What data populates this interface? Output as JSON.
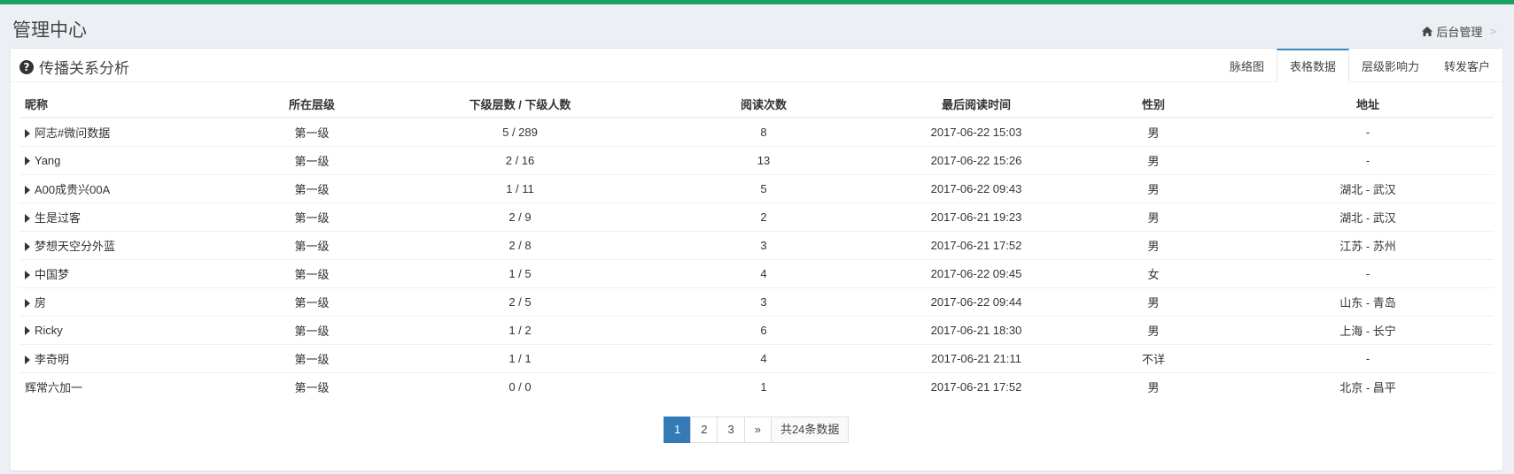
{
  "header": {
    "title": "管理中心",
    "breadcrumb": {
      "home_label": "后台管理",
      "separator": ">"
    }
  },
  "box": {
    "title": "传播关系分析",
    "tabs": [
      {
        "label": "脉络图",
        "active": false
      },
      {
        "label": "表格数据",
        "active": true
      },
      {
        "label": "层级影响力",
        "active": false
      },
      {
        "label": "转发客户",
        "active": false
      }
    ]
  },
  "table": {
    "columns": [
      "昵称",
      "所在层级",
      "下级层数 / 下级人数",
      "阅读次数",
      "最后阅读时间",
      "性别",
      "地址"
    ],
    "rows": [
      {
        "expandable": true,
        "nickname": "阿志#微问数据",
        "level": "第一级",
        "sub": "5 / 289",
        "reads": "8",
        "last_read": "2017-06-22 15:03",
        "gender": "男",
        "address": "-"
      },
      {
        "expandable": true,
        "nickname": "Yang",
        "level": "第一级",
        "sub": "2 / 16",
        "reads": "13",
        "last_read": "2017-06-22 15:26",
        "gender": "男",
        "address": "-"
      },
      {
        "expandable": true,
        "nickname": "A00成贵兴00A",
        "level": "第一级",
        "sub": "1 / 11",
        "reads": "5",
        "last_read": "2017-06-22 09:43",
        "gender": "男",
        "address": "湖北 - 武汉"
      },
      {
        "expandable": true,
        "nickname": "生是过客",
        "level": "第一级",
        "sub": "2 / 9",
        "reads": "2",
        "last_read": "2017-06-21 19:23",
        "gender": "男",
        "address": "湖北 - 武汉"
      },
      {
        "expandable": true,
        "nickname": "梦想天空分外蓝",
        "level": "第一级",
        "sub": "2 / 8",
        "reads": "3",
        "last_read": "2017-06-21 17:52",
        "gender": "男",
        "address": "江苏 - 苏州"
      },
      {
        "expandable": true,
        "nickname": "中国梦",
        "level": "第一级",
        "sub": "1 / 5",
        "reads": "4",
        "last_read": "2017-06-22 09:45",
        "gender": "女",
        "address": "-"
      },
      {
        "expandable": true,
        "nickname": "房",
        "level": "第一级",
        "sub": "2 / 5",
        "reads": "3",
        "last_read": "2017-06-22 09:44",
        "gender": "男",
        "address": "山东 - 青岛"
      },
      {
        "expandable": true,
        "nickname": "Ricky",
        "level": "第一级",
        "sub": "1 / 2",
        "reads": "6",
        "last_read": "2017-06-21 18:30",
        "gender": "男",
        "address": "上海 - 长宁"
      },
      {
        "expandable": true,
        "nickname": "李奇明",
        "level": "第一级",
        "sub": "1 / 1",
        "reads": "4",
        "last_read": "2017-06-21 21:11",
        "gender": "不详",
        "address": "-"
      },
      {
        "expandable": false,
        "nickname": "辉常六加一",
        "level": "第一级",
        "sub": "0 / 0",
        "reads": "1",
        "last_read": "2017-06-21 17:52",
        "gender": "男",
        "address": "北京 - 昌平"
      }
    ]
  },
  "pagination": {
    "pages": [
      "1",
      "2",
      "3"
    ],
    "current": "1",
    "next_label": "»",
    "total_label": "共24条数据"
  },
  "colors": {
    "top_bar": "#1aa260",
    "accent": "#337ab7",
    "tab_active": "#3c8dbc"
  }
}
